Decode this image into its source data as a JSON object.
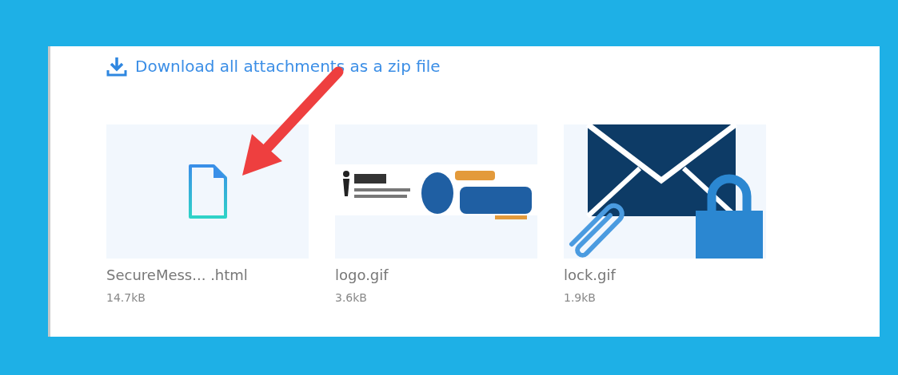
{
  "download_link": "Download all attachments as a zip file",
  "attachments": [
    {
      "kind": "file",
      "name": "SecureMess... .html",
      "size": "14.7kB"
    },
    {
      "kind": "picture",
      "name": "logo.gif",
      "size": "3.6kB"
    },
    {
      "kind": "envelope",
      "name": "lock.gif",
      "size": "1.9kB"
    }
  ]
}
